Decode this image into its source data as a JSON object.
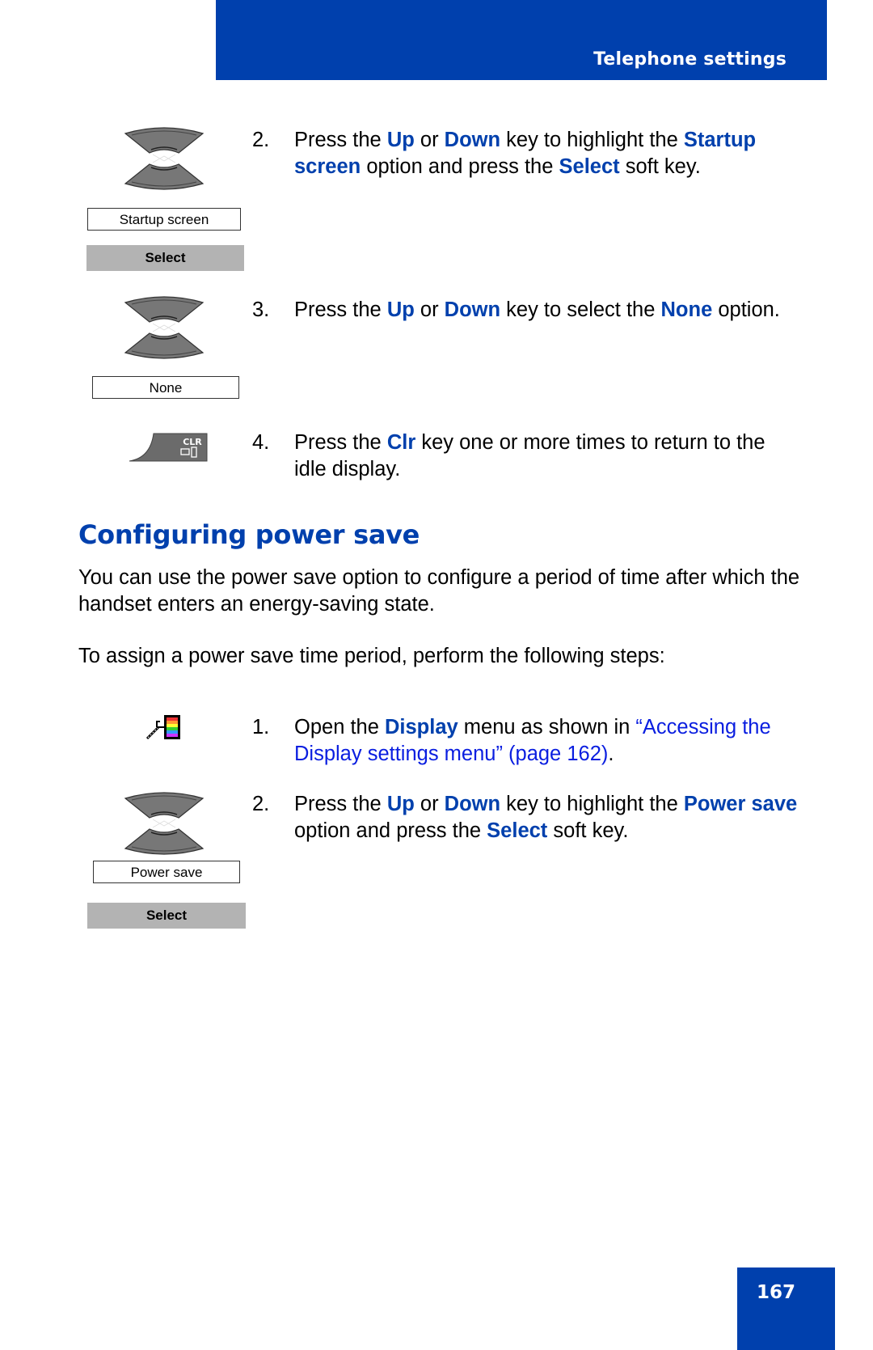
{
  "header": {
    "section_title": "Telephone settings"
  },
  "steps_top": [
    {
      "number": "2.",
      "parts": [
        "Press the ",
        "Up",
        " or ",
        "Down",
        " key to highlight the ",
        "Startup screen",
        " option and press the ",
        "Select",
        " soft key."
      ]
    },
    {
      "number": "3.",
      "parts": [
        "Press the ",
        "Up",
        " or ",
        "Down",
        " key to select the ",
        "None",
        " option."
      ]
    },
    {
      "number": "4.",
      "parts": [
        "Press the ",
        "Clr",
        " key one or more times to return to the idle display."
      ]
    }
  ],
  "widgets_top": {
    "screen_startup": "Startup screen",
    "softkey_select_1": "Select",
    "screen_none": "None",
    "clr_key_label": "CLR"
  },
  "section": {
    "heading": "Configuring power save",
    "intro": "You can use the power save option to configure a period of time after which the handset enters an energy-saving state.",
    "lead_in": "To assign a power save time period, perform the following steps:"
  },
  "steps_bottom": [
    {
      "number": "1.",
      "parts": [
        "Open the ",
        "Display",
        " menu as shown in "
      ],
      "link": "“Accessing the Display settings menu” (page 162)",
      "after_link": "."
    },
    {
      "number": "2.",
      "parts": [
        "Press the ",
        "Up",
        " or ",
        "Down",
        " key to highlight the ",
        "Power save",
        " option and press the ",
        "Select",
        " soft key."
      ]
    }
  ],
  "widgets_bottom": {
    "screen_power_save": "Power save",
    "softkey_select_2": "Select"
  },
  "icons": {
    "nav_key": "up-down-navigation-key-icon",
    "clr_key": "clear-key-icon",
    "display_menu": "display-settings-icon"
  },
  "colors": {
    "brand_blue": "#0040ad",
    "link_blue": "#0a1ee0",
    "softkey_gray": "#b3b3b3"
  },
  "footer": {
    "page_number": "167"
  }
}
